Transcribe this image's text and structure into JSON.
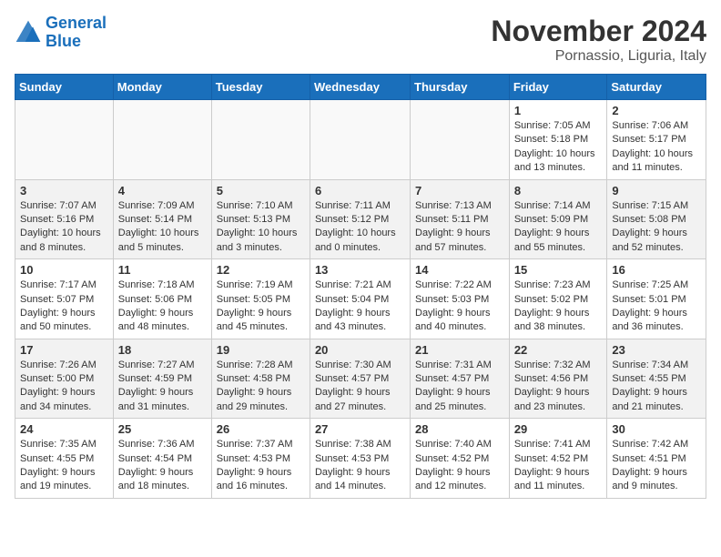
{
  "header": {
    "logo_line1": "General",
    "logo_line2": "Blue",
    "month": "November 2024",
    "location": "Pornassio, Liguria, Italy"
  },
  "weekdays": [
    "Sunday",
    "Monday",
    "Tuesday",
    "Wednesday",
    "Thursday",
    "Friday",
    "Saturday"
  ],
  "weeks": [
    [
      {
        "day": "",
        "info": ""
      },
      {
        "day": "",
        "info": ""
      },
      {
        "day": "",
        "info": ""
      },
      {
        "day": "",
        "info": ""
      },
      {
        "day": "",
        "info": ""
      },
      {
        "day": "1",
        "info": "Sunrise: 7:05 AM\nSunset: 5:18 PM\nDaylight: 10 hours and 13 minutes."
      },
      {
        "day": "2",
        "info": "Sunrise: 7:06 AM\nSunset: 5:17 PM\nDaylight: 10 hours and 11 minutes."
      }
    ],
    [
      {
        "day": "3",
        "info": "Sunrise: 7:07 AM\nSunset: 5:16 PM\nDaylight: 10 hours and 8 minutes."
      },
      {
        "day": "4",
        "info": "Sunrise: 7:09 AM\nSunset: 5:14 PM\nDaylight: 10 hours and 5 minutes."
      },
      {
        "day": "5",
        "info": "Sunrise: 7:10 AM\nSunset: 5:13 PM\nDaylight: 10 hours and 3 minutes."
      },
      {
        "day": "6",
        "info": "Sunrise: 7:11 AM\nSunset: 5:12 PM\nDaylight: 10 hours and 0 minutes."
      },
      {
        "day": "7",
        "info": "Sunrise: 7:13 AM\nSunset: 5:11 PM\nDaylight: 9 hours and 57 minutes."
      },
      {
        "day": "8",
        "info": "Sunrise: 7:14 AM\nSunset: 5:09 PM\nDaylight: 9 hours and 55 minutes."
      },
      {
        "day": "9",
        "info": "Sunrise: 7:15 AM\nSunset: 5:08 PM\nDaylight: 9 hours and 52 minutes."
      }
    ],
    [
      {
        "day": "10",
        "info": "Sunrise: 7:17 AM\nSunset: 5:07 PM\nDaylight: 9 hours and 50 minutes."
      },
      {
        "day": "11",
        "info": "Sunrise: 7:18 AM\nSunset: 5:06 PM\nDaylight: 9 hours and 48 minutes."
      },
      {
        "day": "12",
        "info": "Sunrise: 7:19 AM\nSunset: 5:05 PM\nDaylight: 9 hours and 45 minutes."
      },
      {
        "day": "13",
        "info": "Sunrise: 7:21 AM\nSunset: 5:04 PM\nDaylight: 9 hours and 43 minutes."
      },
      {
        "day": "14",
        "info": "Sunrise: 7:22 AM\nSunset: 5:03 PM\nDaylight: 9 hours and 40 minutes."
      },
      {
        "day": "15",
        "info": "Sunrise: 7:23 AM\nSunset: 5:02 PM\nDaylight: 9 hours and 38 minutes."
      },
      {
        "day": "16",
        "info": "Sunrise: 7:25 AM\nSunset: 5:01 PM\nDaylight: 9 hours and 36 minutes."
      }
    ],
    [
      {
        "day": "17",
        "info": "Sunrise: 7:26 AM\nSunset: 5:00 PM\nDaylight: 9 hours and 34 minutes."
      },
      {
        "day": "18",
        "info": "Sunrise: 7:27 AM\nSunset: 4:59 PM\nDaylight: 9 hours and 31 minutes."
      },
      {
        "day": "19",
        "info": "Sunrise: 7:28 AM\nSunset: 4:58 PM\nDaylight: 9 hours and 29 minutes."
      },
      {
        "day": "20",
        "info": "Sunrise: 7:30 AM\nSunset: 4:57 PM\nDaylight: 9 hours and 27 minutes."
      },
      {
        "day": "21",
        "info": "Sunrise: 7:31 AM\nSunset: 4:57 PM\nDaylight: 9 hours and 25 minutes."
      },
      {
        "day": "22",
        "info": "Sunrise: 7:32 AM\nSunset: 4:56 PM\nDaylight: 9 hours and 23 minutes."
      },
      {
        "day": "23",
        "info": "Sunrise: 7:34 AM\nSunset: 4:55 PM\nDaylight: 9 hours and 21 minutes."
      }
    ],
    [
      {
        "day": "24",
        "info": "Sunrise: 7:35 AM\nSunset: 4:55 PM\nDaylight: 9 hours and 19 minutes."
      },
      {
        "day": "25",
        "info": "Sunrise: 7:36 AM\nSunset: 4:54 PM\nDaylight: 9 hours and 18 minutes."
      },
      {
        "day": "26",
        "info": "Sunrise: 7:37 AM\nSunset: 4:53 PM\nDaylight: 9 hours and 16 minutes."
      },
      {
        "day": "27",
        "info": "Sunrise: 7:38 AM\nSunset: 4:53 PM\nDaylight: 9 hours and 14 minutes."
      },
      {
        "day": "28",
        "info": "Sunrise: 7:40 AM\nSunset: 4:52 PM\nDaylight: 9 hours and 12 minutes."
      },
      {
        "day": "29",
        "info": "Sunrise: 7:41 AM\nSunset: 4:52 PM\nDaylight: 9 hours and 11 minutes."
      },
      {
        "day": "30",
        "info": "Sunrise: 7:42 AM\nSunset: 4:51 PM\nDaylight: 9 hours and 9 minutes."
      }
    ]
  ]
}
